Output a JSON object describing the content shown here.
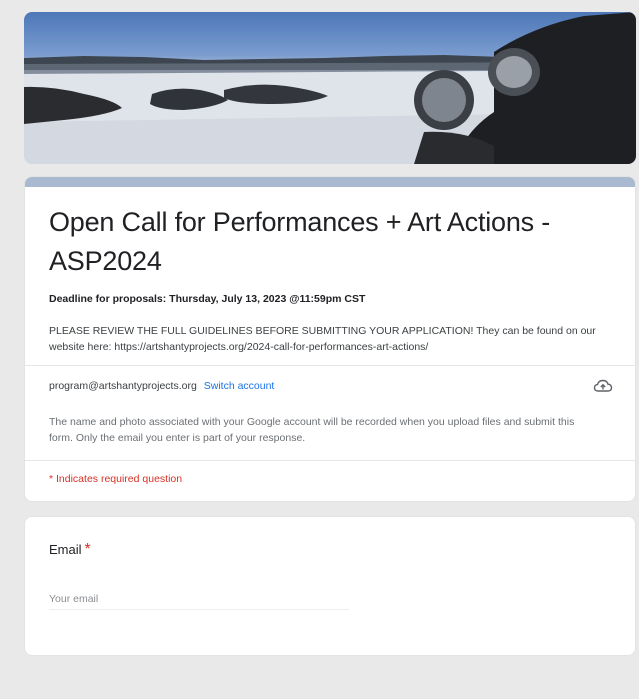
{
  "form": {
    "title": "Open Call for Performances + Art Actions - ASP2024",
    "deadline": "Deadline for proposals: Thursday, July 13, 2023 @11:59pm CST",
    "description": "PLEASE REVIEW THE FULL GUIDELINES BEFORE SUBMITTING YOUR APPLICATION! They can be found on our website here: https://artshantyprojects.org/2024-call-for-performances-art-actions/"
  },
  "account": {
    "email": "program@artshantyprojects.org",
    "switch_label": "Switch account",
    "cloud_icon": "cloud-upload-icon",
    "notice": "The name and photo associated with your Google account will be recorded when you upload files and submit this form. Only the email you enter is part of your response."
  },
  "required_note": "* Indicates required question",
  "email_question": {
    "label": "Email",
    "required_mark": "*",
    "placeholder": "Your email"
  },
  "colors": {
    "accent_bar": "#a9b9cf",
    "link": "#1a73e8",
    "required": "#d93025"
  }
}
